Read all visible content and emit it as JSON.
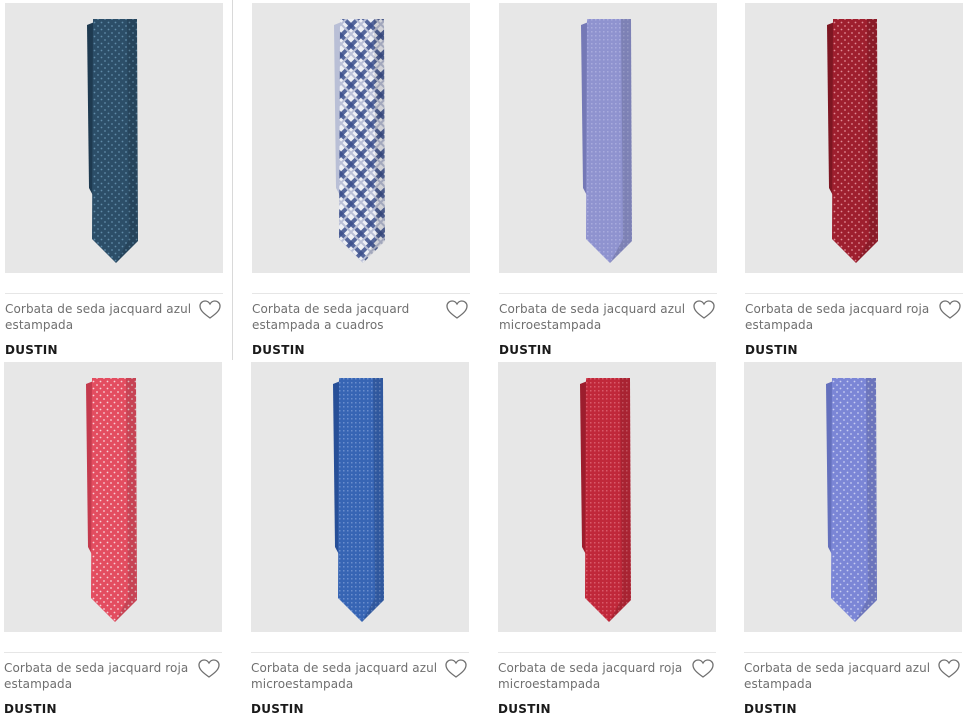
{
  "products": [
    {
      "title": "Corbata de seda jacquard azul estampada",
      "brand": "DUSTIN",
      "image_alt": "Corbata de seda jacquard azul estampada",
      "tie": {
        "base": "#2c4e68",
        "dark": "#1e3a50",
        "accent": "#5f8aa8",
        "pattern": "dots"
      },
      "favorite_icon": "heart-outline-icon"
    },
    {
      "title": "Corbata de seda jacquard estampada a cuadros",
      "brand": "DUSTIN",
      "image_alt": "Corbata de seda jacquard estampada a cuadros",
      "tie": {
        "base": "#eef0f6",
        "dark": "#b9bfd6",
        "accent": "#3b4f8c",
        "pattern": "check"
      },
      "favorite_icon": "heart-outline-icon"
    },
    {
      "title": "Corbata de seda jacquard azul microestampada",
      "brand": "DUSTIN",
      "image_alt": "Corbata de seda jacquard azul microestampada",
      "tie": {
        "base": "#8f93cf",
        "dark": "#7579b6",
        "accent": "#b3b6e3",
        "pattern": "micro"
      },
      "favorite_icon": "heart-outline-icon"
    },
    {
      "title": "Corbata de seda jacquard roja estampada",
      "brand": "DUSTIN",
      "image_alt": "Corbata de seda jacquard roja estampada",
      "tie": {
        "base": "#9e1f2e",
        "dark": "#7d1622",
        "accent": "#e08a94",
        "pattern": "dots"
      },
      "favorite_icon": "heart-outline-icon"
    },
    {
      "title": "Corbata de seda jacquard roja estampada",
      "brand": "DUSTIN",
      "image_alt": "Corbata de seda jacquard roja estampada",
      "tie": {
        "base": "#e34d60",
        "dark": "#c43a4d",
        "accent": "#f7d2d8",
        "pattern": "dots"
      },
      "favorite_icon": "heart-outline-icon"
    },
    {
      "title": "Corbata de seda jacquard azul microestampada",
      "brand": "DUSTIN",
      "image_alt": "Corbata de seda jacquard azul microestampada",
      "tie": {
        "base": "#3765b4",
        "dark": "#274f97",
        "accent": "#7f9fd8",
        "pattern": "micro"
      },
      "favorite_icon": "heart-outline-icon"
    },
    {
      "title": "Corbata de seda jacquard roja microestampada",
      "brand": "DUSTIN",
      "image_alt": "Corbata de seda jacquard roja microestampada",
      "tie": {
        "base": "#c0283a",
        "dark": "#9c1d2d",
        "accent": "#e4707e",
        "pattern": "micro"
      },
      "favorite_icon": "heart-outline-icon"
    },
    {
      "title": "Corbata de seda jacquard azul estampada",
      "brand": "DUSTIN",
      "image_alt": "Corbata de seda jacquard azul estampada",
      "tie": {
        "base": "#7b86d6",
        "dark": "#6470bd",
        "accent": "#c9cff2",
        "pattern": "dots"
      },
      "favorite_icon": "heart-outline-icon"
    }
  ]
}
